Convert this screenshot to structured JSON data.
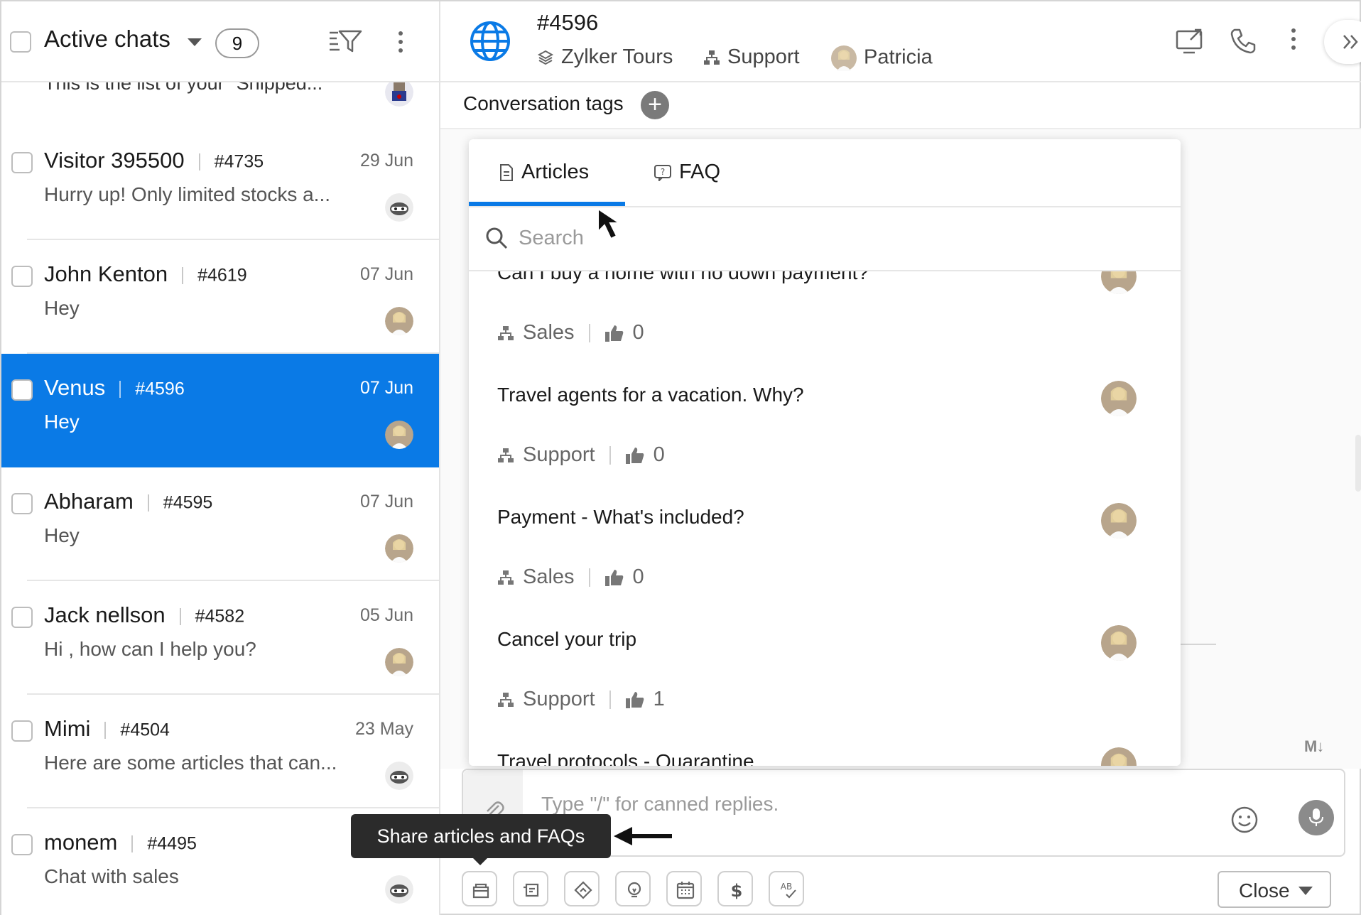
{
  "left_panel": {
    "title": "Active chats",
    "count": "9",
    "partial_preview": "This is the list of your \"Shipped...",
    "chats": [
      {
        "name": "Visitor 395500",
        "id": "#4735",
        "date": "29 Jun",
        "message": "Hurry up! Only limited stocks a...",
        "avatar": "bot-avatar"
      },
      {
        "name": "John Kenton",
        "id": "#4619",
        "date": "07 Jun",
        "message": "Hey",
        "avatar": "user-avatar"
      },
      {
        "name": "Venus",
        "id": "#4596",
        "date": "07 Jun",
        "message": "Hey",
        "avatar": "user-avatar",
        "active": true
      },
      {
        "name": "Abharam",
        "id": "#4595",
        "date": "07 Jun",
        "message": "Hey",
        "avatar": "user-avatar"
      },
      {
        "name": "Jack nellson",
        "id": "#4582",
        "date": "05 Jun",
        "message": "Hi , how can I help you?",
        "avatar": "user-avatar"
      },
      {
        "name": "Mimi",
        "id": "#4504",
        "date": "23 May",
        "message": "Here are some articles that can...",
        "avatar": "bot-avatar"
      },
      {
        "name": "monem",
        "id": "#4495",
        "date": "",
        "message": "Chat with sales",
        "avatar": "bot-avatar"
      }
    ]
  },
  "header": {
    "conversation_id": "#4596",
    "brand": "Zylker Tours",
    "department": "Support",
    "operator": "Patricia"
  },
  "tags": {
    "label": "Conversation tags"
  },
  "popup": {
    "tabs": [
      "Articles",
      "FAQ"
    ],
    "active_tab": "Articles",
    "search_placeholder": "Search",
    "articles": [
      {
        "title": "Can I buy a home with no down payment?",
        "department": "Sales",
        "likes": "0"
      },
      {
        "title": "Travel agents for a vacation. Why?",
        "department": "Support",
        "likes": "0"
      },
      {
        "title": "Payment - What's included?",
        "department": "Sales",
        "likes": "0"
      },
      {
        "title": "Cancel your trip",
        "department": "Support",
        "likes": "1"
      },
      {
        "title": "Travel protocols - Quarantine",
        "department": "",
        "likes": ""
      }
    ]
  },
  "composer": {
    "placeholder": "Type \"/\" for canned replies.",
    "markdown_label": "M↓"
  },
  "toolbar": {
    "tooltip": "Share articles and FAQs",
    "buttons": [
      "articles-icon",
      "canned-icon",
      "routing-icon",
      "bulb-icon",
      "calendar-icon",
      "dollar-icon",
      "spellcheck-icon"
    ]
  },
  "close_button": {
    "label": "Close"
  },
  "colors": {
    "accent": "#0a7ae6",
    "active_row": "#0a7ae6",
    "tooltip_bg": "#2b2b2b"
  }
}
